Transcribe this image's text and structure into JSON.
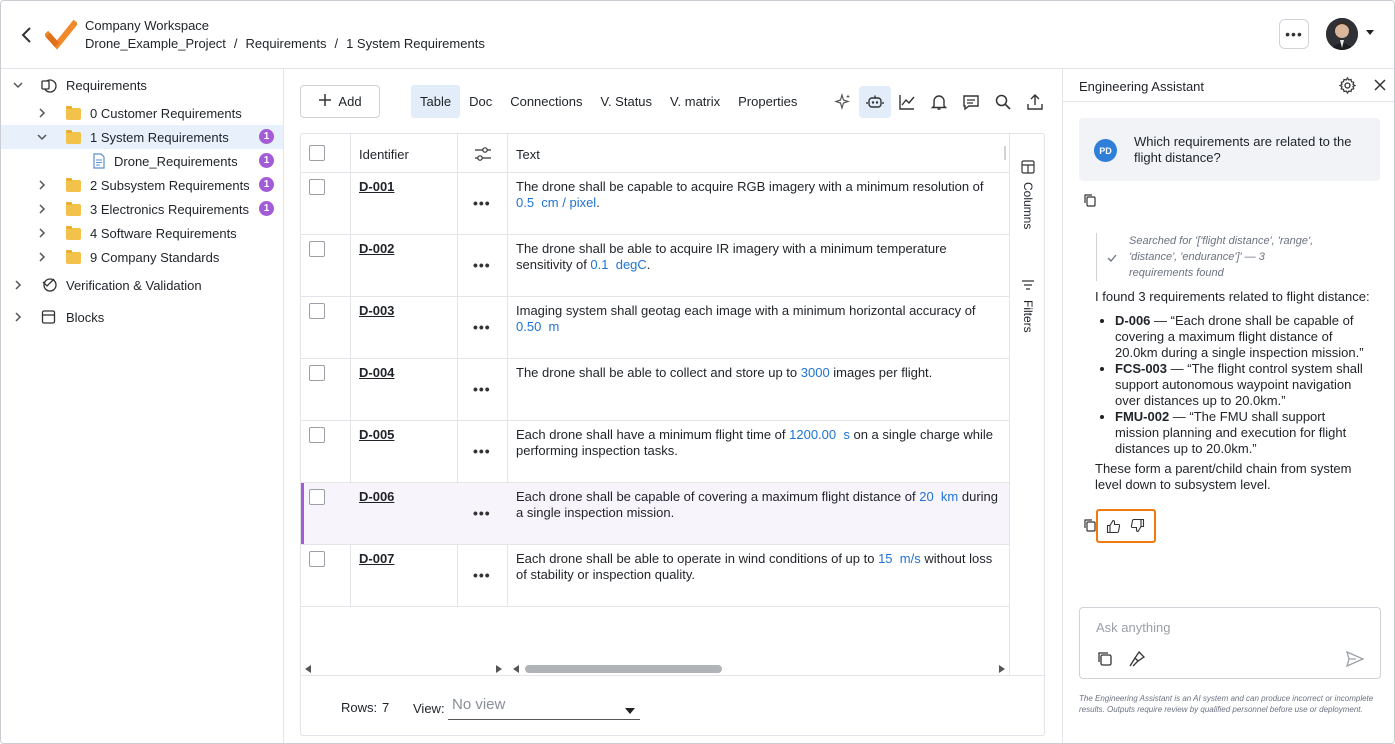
{
  "header": {
    "workspace": "Company Workspace",
    "breadcrumb": [
      "Drone_Example_Project",
      "Requirements",
      "1 System Requirements"
    ],
    "breadcrumb_sep": "/",
    "more_label": "•••"
  },
  "sidebar": {
    "items": [
      {
        "label": "Requirements",
        "badge": ""
      },
      {
        "label": "0 Customer Requirements",
        "badge": ""
      },
      {
        "label": "1 System Requirements",
        "badge": "1"
      },
      {
        "label": "Drone_Requirements",
        "badge": "1"
      },
      {
        "label": "2 Subsystem Requirements",
        "badge": "1"
      },
      {
        "label": "3 Electronics Requirements",
        "badge": "1"
      },
      {
        "label": "4 Software Requirements",
        "badge": ""
      },
      {
        "label": "9 Company Standards",
        "badge": ""
      },
      {
        "label": "Verification & Validation",
        "badge": ""
      },
      {
        "label": "Blocks",
        "badge": ""
      }
    ]
  },
  "toolbar": {
    "add_label": "Add",
    "tabs": [
      "Table",
      "Doc",
      "Connections",
      "V. Status",
      "V. matrix",
      "Properties"
    ]
  },
  "table": {
    "headers": {
      "identifier": "Identifier",
      "text": "Text"
    },
    "side_tabs": [
      "Columns",
      "Filters"
    ],
    "rows": [
      {
        "id": "D-001",
        "pre": "The drone shall be capable to acquire RGB imagery with a minimum resolution of ",
        "value": "0.5  cm / pixel",
        "post": "."
      },
      {
        "id": "D-002",
        "pre": "The drone shall be able to acquire IR imagery with a minimum temperature sensitivity of ",
        "value": "0.1  degC",
        "post": "."
      },
      {
        "id": "D-003",
        "pre": "Imaging system shall geotag each image with a minimum horizontal accuracy of ",
        "value": "0.50  m",
        "post": ""
      },
      {
        "id": "D-004",
        "pre": "The drone shall be able to collect and store up to ",
        "value": "3000",
        "post": " images per flight."
      },
      {
        "id": "D-005",
        "pre": "Each drone shall have a minimum flight time of ",
        "value": "1200.00  s",
        "post": " on a single charge while performing inspection tasks."
      },
      {
        "id": "D-006",
        "pre": "Each drone shall be capable of covering a maximum flight distance of ",
        "value": "20  km",
        "post": " during a single inspection mission."
      },
      {
        "id": "D-007",
        "pre": "Each drone shall be able to operate in wind conditions of up to ",
        "value": "15  m/s",
        "post": " without loss of stability or inspection quality."
      }
    ],
    "dots_label": "•••",
    "footer": {
      "rows_label": "Rows:",
      "rows_count": "7",
      "view_label": "View:",
      "view_value": "No view"
    }
  },
  "assistant": {
    "title": "Engineering Assistant",
    "user_initials": "PD",
    "question": "Which requirements are related to the flight distance?",
    "searched": "Searched for '['flight distance', 'range', 'distance', 'endurance']' — 3 requirements found",
    "intro": "I found 3 requirements related to flight distance:",
    "results": [
      {
        "id": "D-006",
        "text": " — “Each drone shall be capable of covering a maximum flight distance of 20.0km during a single inspection mission.”"
      },
      {
        "id": "FCS-003",
        "text": " — “The flight control system shall support autonomous waypoint navigation over distances up to 20.0km.”"
      },
      {
        "id": "FMU-002",
        "text": " — “The FMU shall support mission planning and execution for flight distances up to 20.0km.”"
      }
    ],
    "conclusion": "These form a parent/child chain from system level down to subsystem level.",
    "ask_placeholder": "Ask anything",
    "disclaimer": "The Engineering Assistant is an AI system and can produce incorrect or incomplete results. Outputs require review by qualified personnel before use or deployment."
  },
  "colors": {
    "accent": "#1f74d2",
    "badge": "#a35bd6",
    "highlight": "#f07a12",
    "logo": "#f0892a"
  }
}
